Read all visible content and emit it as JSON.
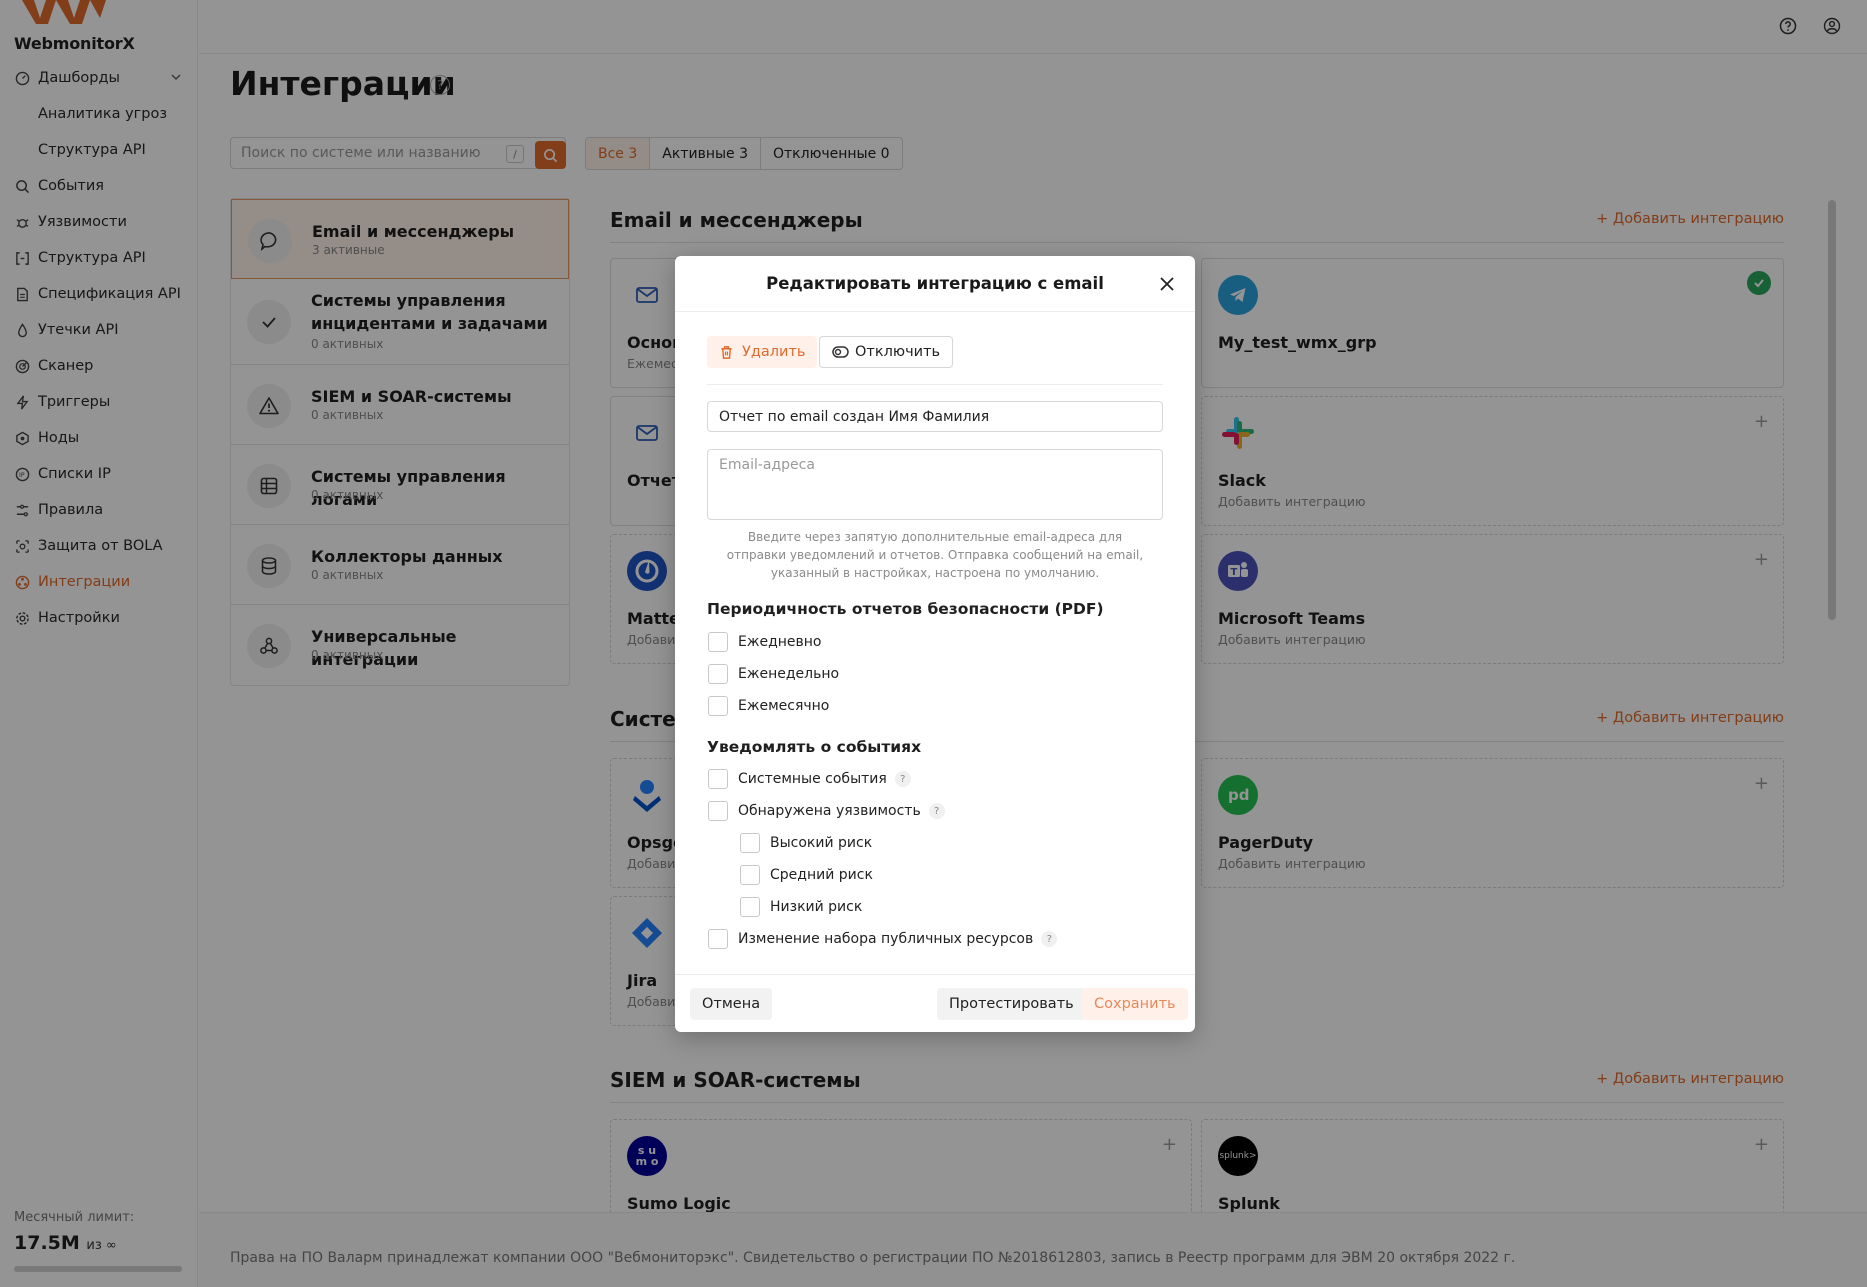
{
  "app": {
    "logo_text": "WebmonitorX",
    "accent": "#e06a2b"
  },
  "sidebar": {
    "items": [
      {
        "label": "Дашборды",
        "icon": "dashboard-icon",
        "expandable": true
      },
      {
        "label": "Аналитика угроз",
        "sub": true
      },
      {
        "label": "Структура API",
        "sub": true
      },
      {
        "label": "События",
        "icon": "search-icon"
      },
      {
        "label": "Уязвимости",
        "icon": "bug-icon"
      },
      {
        "label": "Структура API",
        "icon": "code-brackets-icon"
      },
      {
        "label": "Спецификация API",
        "icon": "document-icon"
      },
      {
        "label": "Утечки API",
        "icon": "drop-icon"
      },
      {
        "label": "Сканер",
        "icon": "radar-icon"
      },
      {
        "label": "Триггеры",
        "icon": "lightning-icon"
      },
      {
        "label": "Ноды",
        "icon": "node-icon"
      },
      {
        "label": "Списки IP",
        "icon": "ip-icon"
      },
      {
        "label": "Правила",
        "icon": "rules-icon"
      },
      {
        "label": "Защита от BOLA",
        "icon": "shield-icon"
      },
      {
        "label": "Интеграции",
        "icon": "integrations-icon",
        "active": true
      },
      {
        "label": "Настройки",
        "icon": "gear-icon"
      }
    ],
    "limit_label": "Месячный лимит:",
    "limit_value": "17.5M",
    "limit_of": "из ∞"
  },
  "main": {
    "title": "Интеграции",
    "search_placeholder": "Поиск по системе или названию",
    "search_shortcut": "/",
    "filters": [
      {
        "label": "Все 3",
        "active": true
      },
      {
        "label": "Активные 3"
      },
      {
        "label": "Отключенные 0"
      }
    ],
    "categories": [
      {
        "title": "Email и мессенджеры",
        "sub": "3 активные",
        "icon": "chat-bubble-icon",
        "active": true
      },
      {
        "title": "Системы управления инцидентами и задачами",
        "sub": "0 активных",
        "icon": "checkmark-icon"
      },
      {
        "title": "SIEM и SOAR-системы",
        "sub": "0 активных",
        "icon": "warning-icon"
      },
      {
        "title": "Системы управления логами",
        "sub": "0 активных",
        "icon": "table-icon"
      },
      {
        "title": "Коллекторы данных",
        "sub": "0 активных",
        "icon": "database-icon"
      },
      {
        "title": "Универсальные интеграции",
        "sub": "0 активных",
        "icon": "webhook-icon"
      }
    ],
    "sections": [
      {
        "title": "Email и мессенджеры",
        "add": "+ Добавить интеграцию"
      },
      {
        "title": "Систе",
        "add": "+ Добавить интеграцию"
      },
      {
        "title": "SIEM и SOAR-системы",
        "add": "+ Добавить интеграцию"
      }
    ],
    "cards": {
      "email1": {
        "name": "Основ",
        "sub": "Ежемес"
      },
      "telegram": {
        "name": "My_test_wmx_grp"
      },
      "email2": {
        "name": "Отчет"
      },
      "slack": {
        "name": "Slack",
        "sub": "Добавить интеграцию"
      },
      "mattermost": {
        "name": "Matter",
        "sub": "Добавит"
      },
      "teams": {
        "name": "Microsoft Teams",
        "sub": "Добавить интеграцию"
      },
      "opsgenie": {
        "name": "Opsge",
        "sub": "Добавит"
      },
      "pagerduty": {
        "name": "PagerDuty",
        "sub": "Добавить интеграцию"
      },
      "jira": {
        "name": "Jira",
        "sub": "Добавит"
      },
      "sumo": {
        "name": "Sumo Logic",
        "logo": "s u\nm o"
      },
      "splunk": {
        "name": "Splunk",
        "logo": "splunk>"
      }
    },
    "footer": "Права на ПО Валарм принадлежат компании ООО \"Вебмониторэкс\". Свидетельство о регистрации ПО №2018612803, запись в Реестр программ для ЭВМ 20 октября 2022 г."
  },
  "modal": {
    "title": "Редактировать интеграцию с email",
    "delete_label": "Удалить",
    "disable_label": "Отключить",
    "name_value": "Отчет по email создан Имя Фамилия",
    "emails_placeholder": "Email-адреса",
    "hint": "Введите через запятую дополнительные email-адреса для отправки уведомлений и отчетов. Отправка сообщений на email, указанный в настройках, настроена по умолчанию.",
    "reports_title": "Периодичность отчетов безопасности (PDF)",
    "reports": [
      "Ежедневно",
      "Еженедельно",
      "Ежемесячно"
    ],
    "events_title": "Уведомлять о событиях",
    "events": {
      "system": "Системные события",
      "vuln": "Обнаружена уязвимость",
      "high": "Высокий риск",
      "medium": "Средний риск",
      "low": "Низкий риск",
      "public": "Изменение набора публичных ресурсов"
    },
    "cancel_label": "Отмена",
    "test_label": "Протестировать",
    "save_label": "Сохранить"
  }
}
